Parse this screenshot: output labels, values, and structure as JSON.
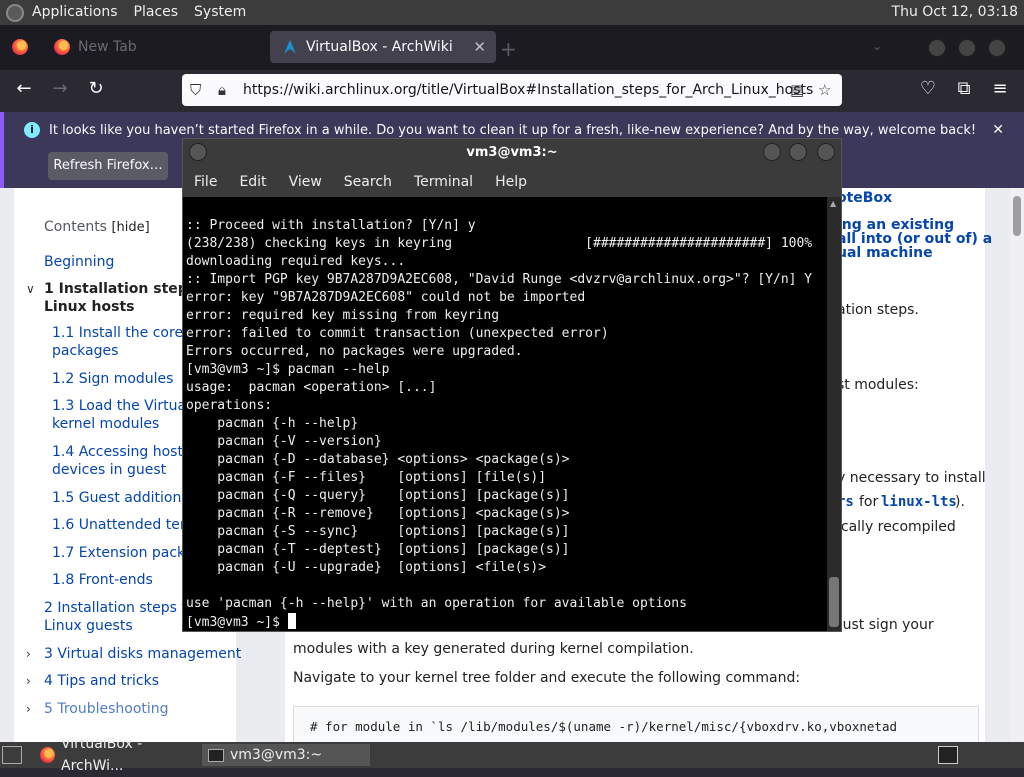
{
  "panel": {
    "menus": [
      "Applications",
      "Places",
      "System"
    ],
    "clock": "Thu Oct 12, 03:18"
  },
  "browser": {
    "tabs": [
      {
        "title": "New Tab",
        "active": false
      },
      {
        "title": "VirtualBox - ArchWiki",
        "active": true
      }
    ],
    "url": "https://wiki.archlinux.org/title/VirtualBox#Installation_steps_for_Arch_Linux_hosts",
    "notification": {
      "message": "It looks like you haven’t started Firefox in a while. Do you want to clean it up for a fresh, like-new experience? And by the way, welcome back!",
      "button": "Refresh Firefox…"
    }
  },
  "toc": {
    "title": "Contents",
    "hide": "[hide]",
    "items": [
      {
        "label": "Beginning"
      },
      {
        "label": "1  Installation steps f"
      },
      {
        "label": "Linux hosts"
      },
      {
        "label": "1.1  Install the core"
      },
      {
        "label": "packages"
      },
      {
        "label": "1.2  Sign modules"
      },
      {
        "label": "1.3  Load the VirtualB"
      },
      {
        "label": "kernel modules"
      },
      {
        "label": "1.4  Accessing host U"
      },
      {
        "label": "devices in guest"
      },
      {
        "label": "1.5  Guest additions d"
      },
      {
        "label": "1.6  Unattended temp"
      },
      {
        "label": "1.7  Extension pack"
      },
      {
        "label": "1.8  Front-ends"
      },
      {
        "label": "2  Installation steps for"
      },
      {
        "label": "Linux guests"
      },
      {
        "label": "3  Virtual disks management"
      },
      {
        "label": "4  Tips and tricks"
      },
      {
        "label": "5  Troubleshooting"
      }
    ]
  },
  "article": {
    "related_1": "oteBox",
    "related_2": "ing an existing",
    "related_3": "all into (or out of) a",
    "related_4": "ual machine",
    "frag_steps": "ation steps.",
    "frag_modules": "st modules:",
    "frag_install": "y necessary to install",
    "frag_for": "rs",
    "frag_for_word": "for",
    "frag_lts": "linux-lts",
    "frag_lts_end": ").",
    "frag_recompiled": "ically recompiled",
    "frag_sign": "must sign your",
    "sign_line": "modules with a key generated during kernel compilation.",
    "navigate_line": "Navigate to your kernel tree folder and execute the following command:",
    "code": "# for module in `ls /lib/modules/$(uname -r)/kernel/misc/{vboxdrv.ko,vboxnetad"
  },
  "terminal": {
    "title": "vm3@vm3:~",
    "menus": [
      "File",
      "Edit",
      "View",
      "Search",
      "Terminal",
      "Help"
    ],
    "lines": [
      ":: Proceed with installation? [Y/n] y",
      "(238/238) checking keys in keyring                 [######################] 100%",
      "downloading required keys...",
      ":: Import PGP key 9B7A287D9A2EC608, \"David Runge <dvzrv@archlinux.org>\"? [Y/n] Y",
      "error: key \"9B7A287D9A2EC608\" could not be imported",
      "error: required key missing from keyring",
      "error: failed to commit transaction (unexpected error)",
      "Errors occurred, no packages were upgraded.",
      "[vm3@vm3 ~]$ pacman --help",
      "usage:  pacman <operation> [...]",
      "operations:",
      "    pacman {-h --help}",
      "    pacman {-V --version}",
      "    pacman {-D --database} <options> <package(s)>",
      "    pacman {-F --files}    [options] [file(s)]",
      "    pacman {-Q --query}    [options] [package(s)]",
      "    pacman {-R --remove}   [options] <package(s)>",
      "    pacman {-S --sync}     [options] [package(s)]",
      "    pacman {-T --deptest}  [options] [package(s)]",
      "    pacman {-U --upgrade}  [options] <file(s)>",
      "",
      "use 'pacman {-h --help}' with an operation for available options"
    ],
    "prompt": "[vm3@vm3 ~]$ "
  },
  "taskbar": {
    "tasks": [
      {
        "title": "VirtualBox - ArchWi..."
      },
      {
        "title": "vm3@vm3:~"
      }
    ]
  }
}
